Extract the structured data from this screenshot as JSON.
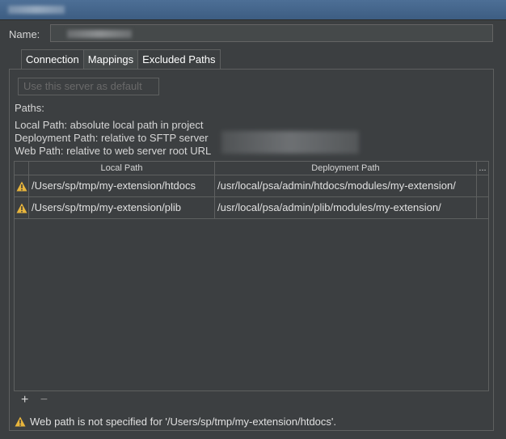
{
  "window": {
    "title_icon": "blurred-title"
  },
  "form": {
    "name_label": "Name:"
  },
  "tabs": [
    {
      "label": "Connection",
      "active": false
    },
    {
      "label": "Mappings",
      "active": true
    },
    {
      "label": "Excluded Paths",
      "active": false
    }
  ],
  "mappings": {
    "default_button_label": "Use this server as default",
    "paths_title": "Paths:",
    "info_lines": [
      "Local Path: absolute local path in project",
      "Deployment Path: relative to SFTP server",
      "Web Path: relative to web server root URL"
    ],
    "table": {
      "columns": [
        "",
        "Local Path",
        "Deployment Path",
        "..."
      ],
      "rows": [
        {
          "local_path": "/Users/sp/tmp/my-extension/htdocs",
          "deployment_path": "/usr/local/psa/admin/htdocs/modules/my-extension/",
          "warning": true
        },
        {
          "local_path": "/Users/sp/tmp/my-extension/plib",
          "deployment_path": "/usr/local/psa/admin/plib/modules/my-extension/",
          "warning": true
        }
      ]
    },
    "add_symbol": "+",
    "remove_symbol": "−",
    "status_message": "Web path is not specified for '/Users/sp/tmp/my-extension/htdocs'."
  },
  "colors": {
    "background": "#3c3f41",
    "warning": "#e8b53c",
    "border": "#5e6060"
  }
}
